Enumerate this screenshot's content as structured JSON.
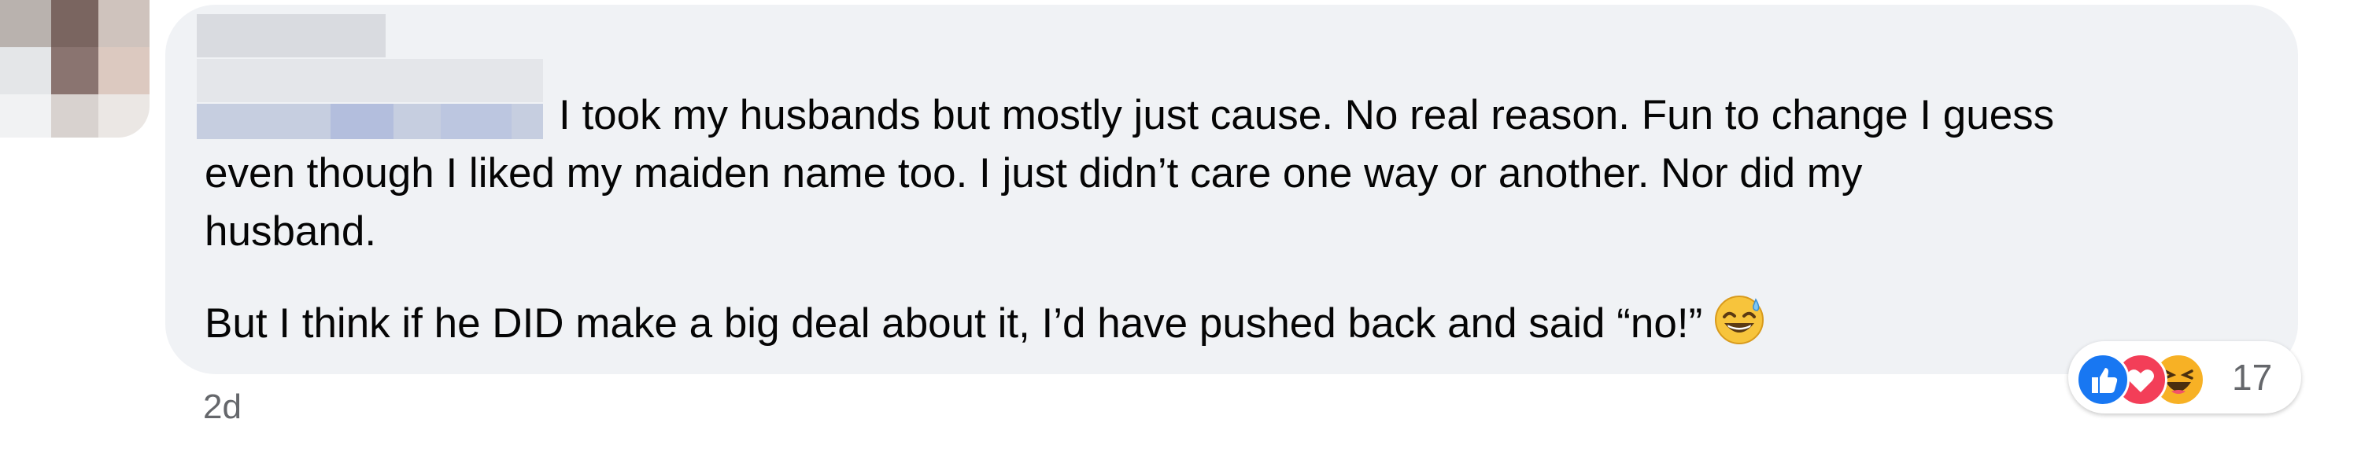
{
  "comment": {
    "lines": [
      "I took my husbands but mostly just cause. No real reason. Fun to change I guess",
      "even though I liked my maiden name too. I just didn’t care one way or another. Nor did my",
      "husband.",
      "But I think if he DID make a big deal about it, I’d have pushed back and said “no!”"
    ],
    "emoji": "grinning-face-with-sweat-emoji"
  },
  "reactions": {
    "count": "17",
    "types": [
      "like-icon",
      "love-icon",
      "haha-icon"
    ]
  },
  "timestamp": "2d",
  "colors": {
    "bubble": "#f0f2f5",
    "text": "#050505",
    "muted": "#65676b",
    "like": "#1877f2",
    "love": "#f33e58",
    "haha": "#f7b125"
  }
}
